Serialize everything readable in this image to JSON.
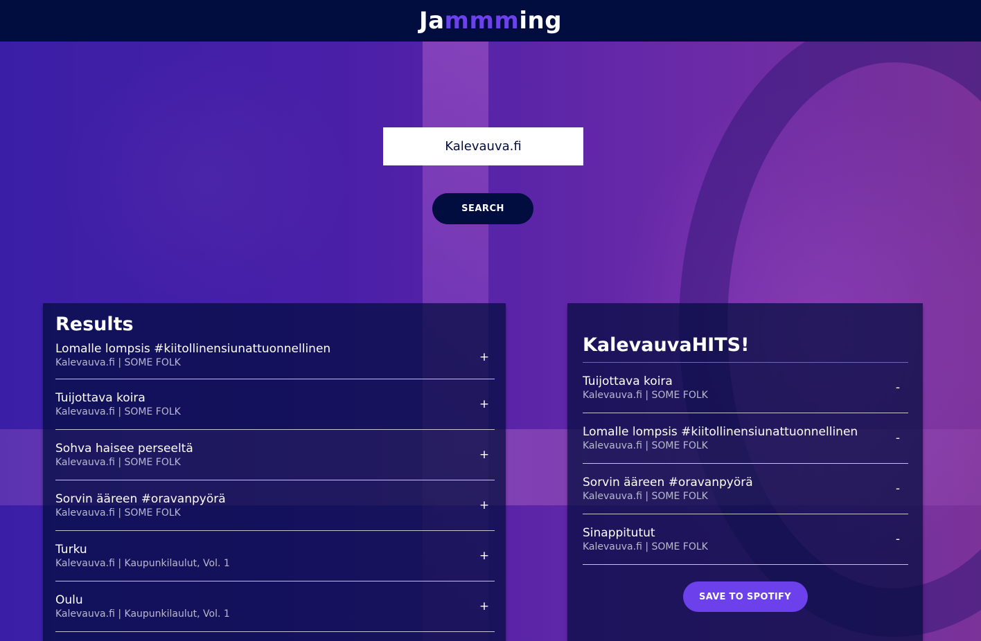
{
  "app": {
    "title_prefix": "Ja",
    "title_accent": "mmm",
    "title_suffix": "ing",
    "accent_color": "#6c41ec",
    "header_color": "#010c3f"
  },
  "search": {
    "value": "Kalevauva.fi",
    "button_label": "SEARCH"
  },
  "results": {
    "title": "Results",
    "tracks": [
      {
        "name": "Lomalle lompsis #kiitollinensiunattuonnellinen",
        "meta": "Kalevauva.fi | SOME FOLK",
        "action": "+"
      },
      {
        "name": "Tuijottava koira",
        "meta": "Kalevauva.fi | SOME FOLK",
        "action": "+"
      },
      {
        "name": "Sohva haisee perseeltä",
        "meta": "Kalevauva.fi | SOME FOLK",
        "action": "+"
      },
      {
        "name": "Sorvin ääreen #oravanpyörä",
        "meta": "Kalevauva.fi | SOME FOLK",
        "action": "+"
      },
      {
        "name": "Turku",
        "meta": "Kalevauva.fi | Kaupunkilaulut, Vol. 1",
        "action": "+"
      },
      {
        "name": "Oulu",
        "meta": "Kalevauva.fi | Kaupunkilaulut, Vol. 1",
        "action": "+"
      }
    ]
  },
  "playlist": {
    "name": "KalevauvaHITS!",
    "tracks": [
      {
        "name": "Tuijottava koira",
        "meta": "Kalevauva.fi | SOME FOLK",
        "action": "-"
      },
      {
        "name": "Lomalle lompsis #kiitollinensiunattuonnellinen",
        "meta": "Kalevauva.fi | SOME FOLK",
        "action": "-"
      },
      {
        "name": "Sorvin ääreen #oravanpyörä",
        "meta": "Kalevauva.fi | SOME FOLK",
        "action": "-"
      },
      {
        "name": "Sinappitutut",
        "meta": "Kalevauva.fi | SOME FOLK",
        "action": "-"
      }
    ],
    "save_label": "SAVE TO SPOTIFY"
  }
}
